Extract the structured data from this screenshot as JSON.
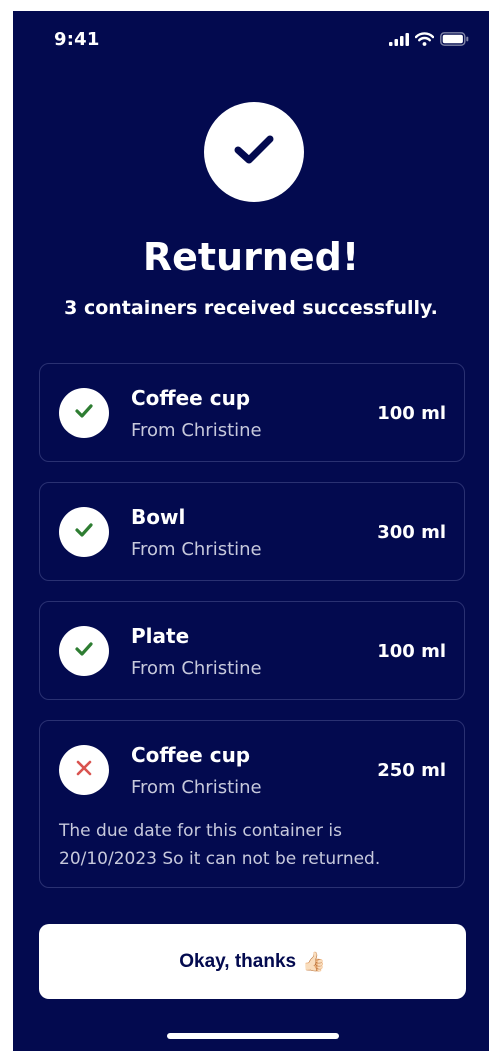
{
  "status_bar": {
    "time": "9:41",
    "icons": [
      "signal-icon",
      "wifi-icon",
      "battery-icon"
    ]
  },
  "hero": {
    "icon": "check-icon",
    "title": "Returned!",
    "subtitle": "3 containers received successfully."
  },
  "colors": {
    "background": "#030a4f",
    "success": "#2e7d32",
    "error": "#d9534f",
    "card_border": "#2a3172"
  },
  "containers": [
    {
      "name": "Coffee cup",
      "from": "From Christine",
      "size": "100 ml",
      "status": "returned",
      "icon": "check-icon"
    },
    {
      "name": "Bowl",
      "from": "From Christine",
      "size": "300 ml",
      "status": "returned",
      "icon": "check-icon"
    },
    {
      "name": "Plate",
      "from": "From Christine",
      "size": "100 ml",
      "status": "returned",
      "icon": "check-icon"
    },
    {
      "name": "Coffee cup",
      "from": "From Christine",
      "size": "250 ml",
      "status": "rejected",
      "icon": "cross-icon",
      "note_line1": "The due date for this container is",
      "note_line2": "20/10/2023 So it can not be returned."
    }
  ],
  "action": {
    "label": "Okay, thanks",
    "emoji": "👍🏻"
  }
}
